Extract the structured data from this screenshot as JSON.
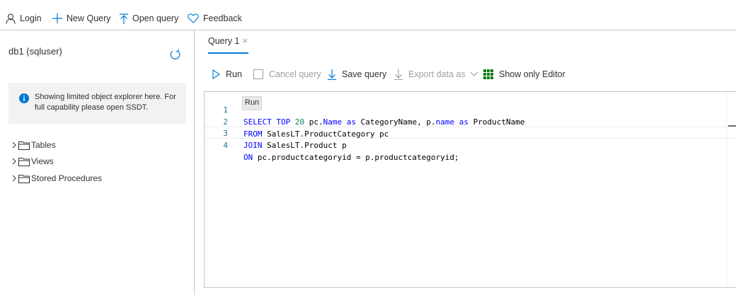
{
  "topbar": {
    "login": "Login",
    "new_query": "New Query",
    "open_query": "Open query",
    "feedback": "Feedback"
  },
  "explorer": {
    "db_title": "db1 (sqluser)",
    "info_text": "Showing limited object explorer here. For full capability please open SSDT.",
    "tree": [
      "Tables",
      "Views",
      "Stored Procedures"
    ]
  },
  "tab": {
    "label": "Query 1",
    "close": "×"
  },
  "actions": {
    "run": "Run",
    "cancel_query": "Cancel query",
    "save_query": "Save query",
    "export_data": "Export data as",
    "show_only_editor": "Show only Editor"
  },
  "editor": {
    "line_numbers": [
      "1",
      "2",
      "3",
      "4"
    ],
    "tooltip": "Run"
  },
  "colors": {
    "accent": "#0078d4",
    "keyword": "#0000ff",
    "number": "#098658",
    "disabled": "#a19f9d",
    "grid_icon": "#107c10"
  }
}
